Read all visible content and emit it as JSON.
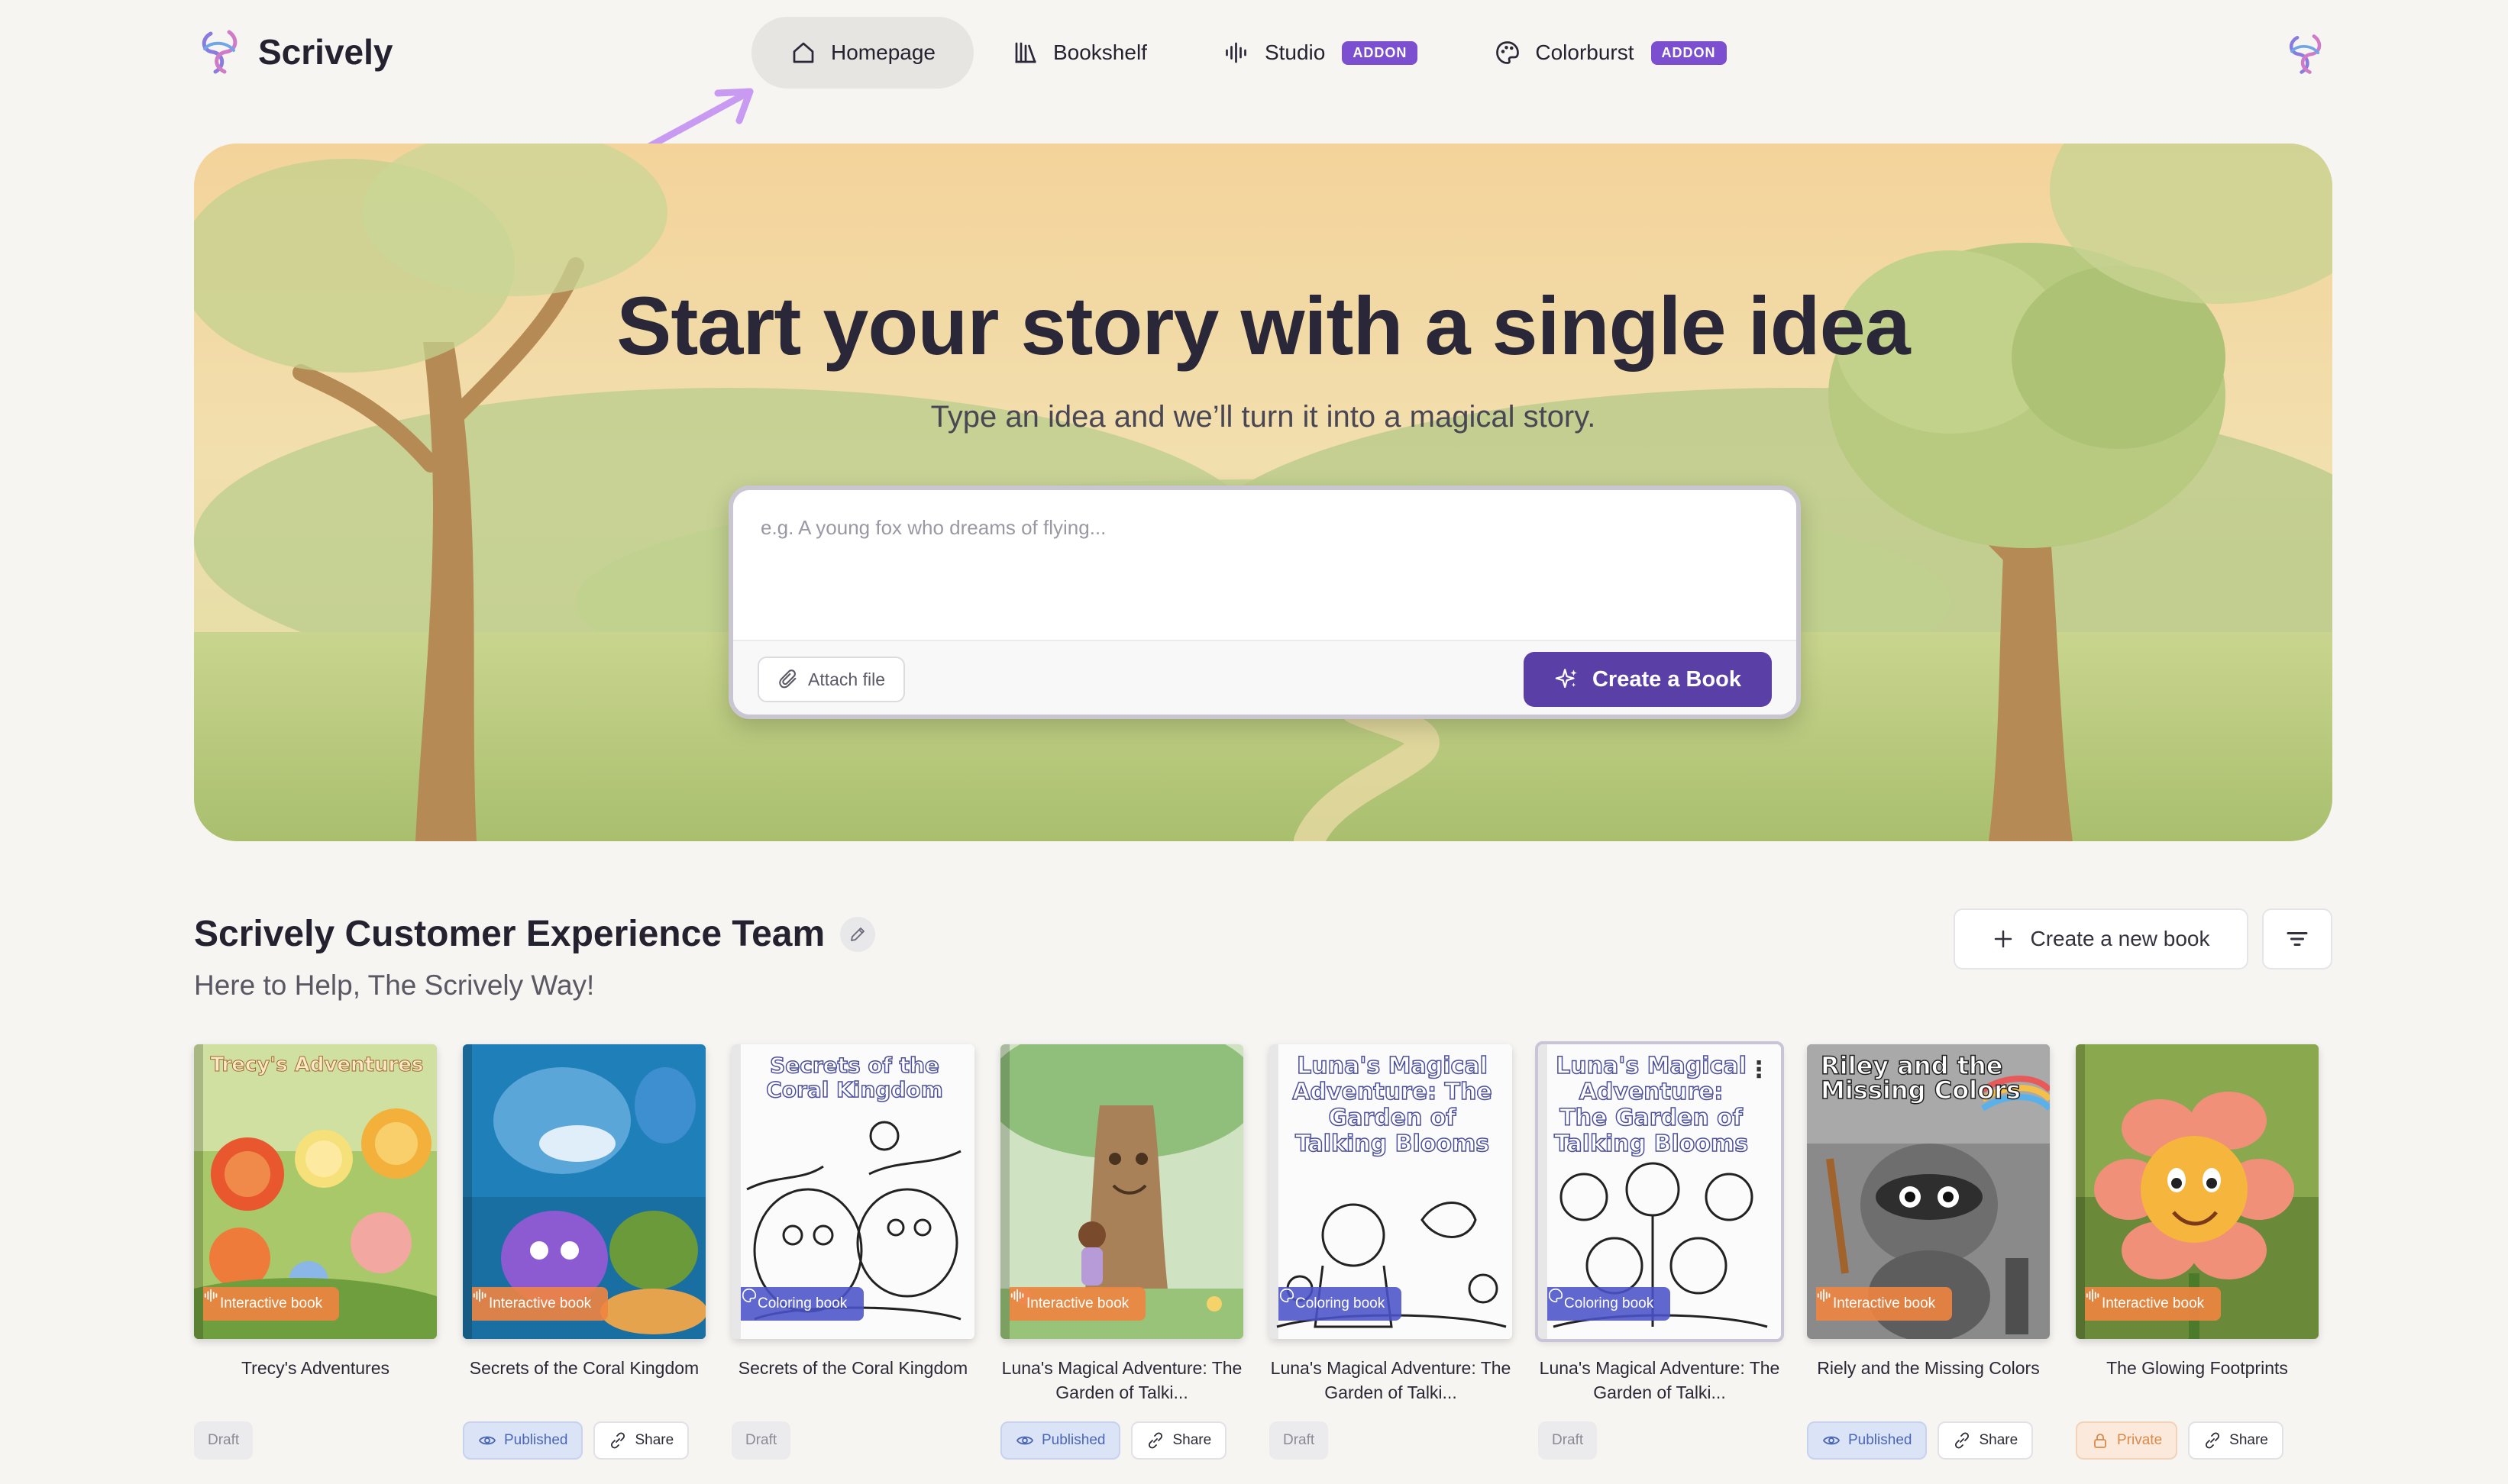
{
  "app": {
    "name": "Scrively"
  },
  "nav": {
    "items": [
      {
        "label": "Homepage",
        "addon": ""
      },
      {
        "label": "Bookshelf",
        "addon": ""
      },
      {
        "label": "Studio",
        "addon": "ADDON"
      },
      {
        "label": "Colorburst",
        "addon": "ADDON"
      }
    ]
  },
  "hero": {
    "title": "Start your story with a single idea",
    "subtitle": "Type an idea and we’ll turn it into a magical story.",
    "placeholder": "e.g. A young fox who dreams of flying...",
    "attach_label": "Attach file",
    "create_label": "Create a Book"
  },
  "team": {
    "name": "Scrively Customer Experience Team",
    "tagline": "Here to Help, The Scrively Way!",
    "new_book_label": "Create a new book"
  },
  "books": [
    {
      "title": "Trecy's Adventures",
      "cover_title": "Trecy's Adventures",
      "type": "Interactive book",
      "status": "Draft",
      "share": ""
    },
    {
      "title": "Secrets of the Coral Kingdom",
      "cover_title": "",
      "type": "Interactive book",
      "status": "Published",
      "share": "Share"
    },
    {
      "title": "Secrets of the Coral Kingdom",
      "cover_title": "Secrets of the Coral Kingdom",
      "type": "Coloring book",
      "status": "Draft",
      "share": ""
    },
    {
      "title": "Luna's Magical Adventure: The Garden of Talki...",
      "cover_title": "",
      "type": "Interactive book",
      "status": "Published",
      "share": "Share"
    },
    {
      "title": "Luna's Magical Adventure: The Garden of Talki...",
      "cover_title": "Luna's Magical Adventure: The Garden of Talking Blooms",
      "type": "Coloring book",
      "status": "Draft",
      "share": ""
    },
    {
      "title": "Luna's Magical Adventure: The Garden of Talki...",
      "cover_title": "Luna's Magical Adventure: The Garden of Talking Blooms",
      "type": "Coloring book",
      "status": "Draft",
      "share": ""
    },
    {
      "title": "Riely and the Missing Colors",
      "cover_title": "Riley and the Missing Colors",
      "type": "Interactive book",
      "status": "Published",
      "share": "Share"
    },
    {
      "title": "The Glowing Footprints",
      "cover_title": "",
      "type": "Interactive book",
      "status": "Private",
      "share": "Share"
    }
  ],
  "colors": {
    "accent": "#5a3fa6",
    "addon": "#7b4fd0",
    "interactive_tag": "#ef8440",
    "coloring_tag": "#4a52c8"
  }
}
